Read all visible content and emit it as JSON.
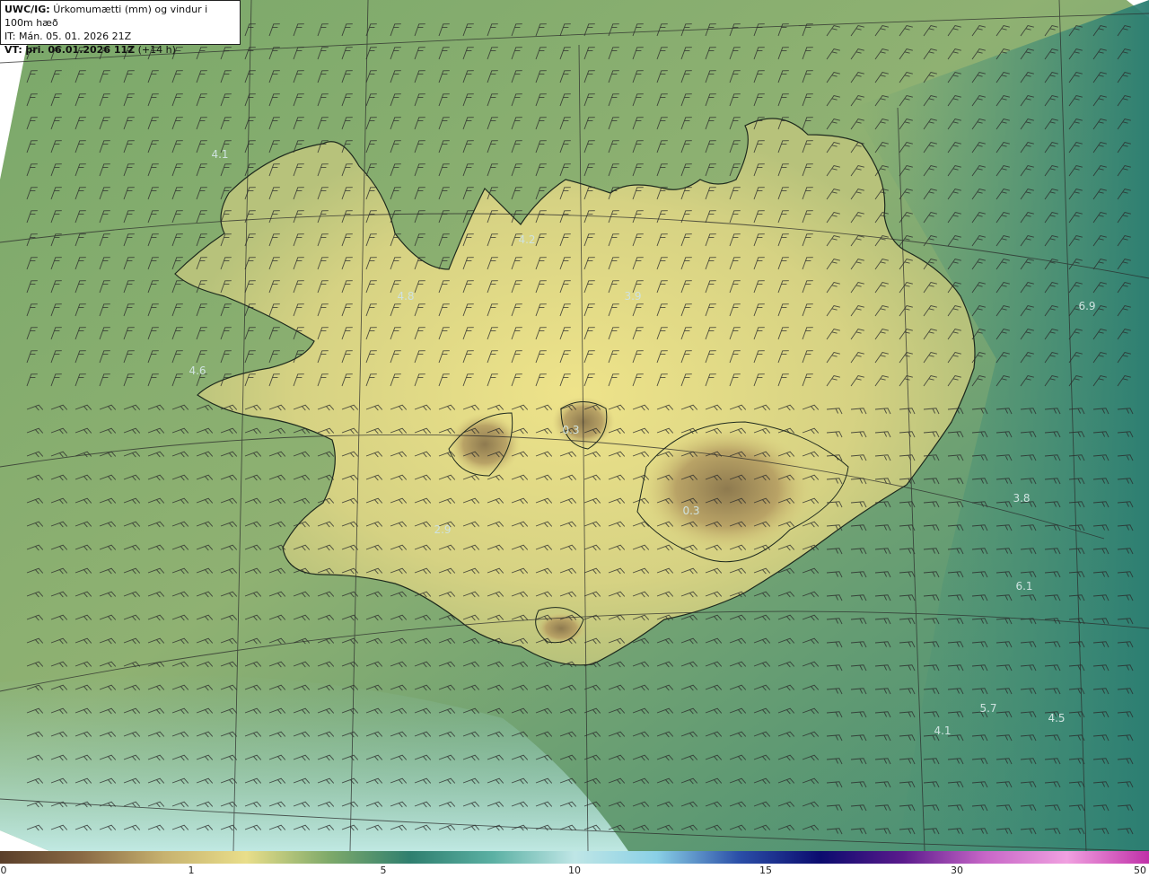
{
  "header": {
    "model_prefix": "UWC/IG:",
    "title": "Úrkomumætti (mm) og vindur i 100m hæð",
    "initial_time": "IT: Mán. 05. 01. 2026 21Z",
    "valid_prefix": "VT:",
    "valid_time": "þri. 06.01.2026 11Z",
    "lead_time": "(+14 h)"
  },
  "values": {
    "v1": "4.1",
    "v2": "4.2",
    "v3": "4.8",
    "v4": "3.9",
    "v5": "4.6",
    "v6": "0.3",
    "v7": "0.3",
    "v8": "2.9",
    "v9": "6.9",
    "v10": "3.8",
    "v11": "6.1",
    "v12": "5.7",
    "v13": "4.5",
    "v14": "4.1"
  },
  "colorbar": {
    "ticks": [
      "0",
      "1",
      "5",
      "10",
      "15",
      "30",
      "50"
    ],
    "colors": [
      "#5a3f2a",
      "#8a6a45",
      "#c7b26f",
      "#e9de8a",
      "#7faa6a",
      "#2f7f6f",
      "#5bb0a3",
      "#bfe6e6",
      "#8ad0e6",
      "#2b4fa8",
      "#0b0b6e",
      "#5a1a8c",
      "#c766c7",
      "#f0a0e0",
      "#c030a8"
    ]
  },
  "map_colors": {
    "land_light": "#e6de86",
    "land_mid": "#b8c27a",
    "sea_green": "#6f9f6a",
    "sea_teal": "#2e7d6f",
    "sea_light": "#a9dcd6",
    "low_precip": "#9a8a5a"
  }
}
